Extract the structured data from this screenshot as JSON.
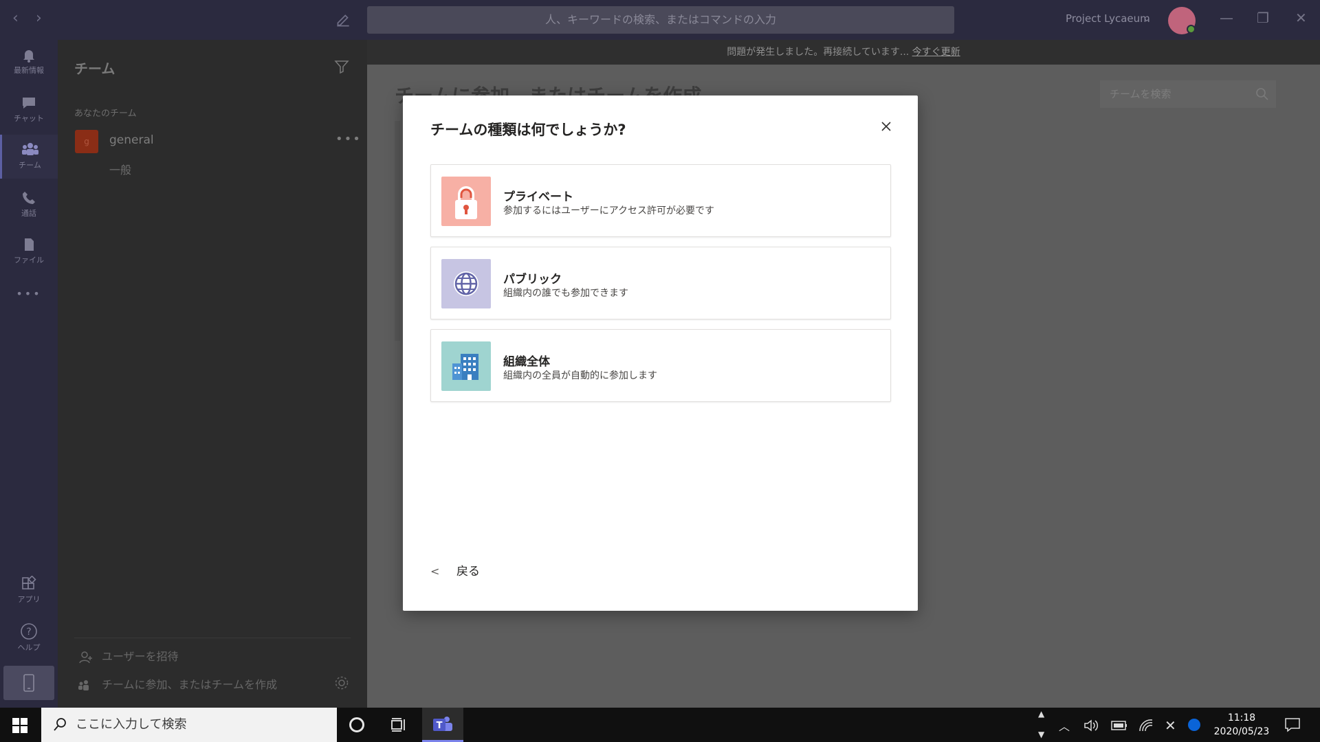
{
  "titlebar": {
    "search_placeholder": "人、キーワードの検索、またはコマンドの入力",
    "tenant": "Project Lycaeum",
    "back_glyph": "‹",
    "forward_glyph": "›"
  },
  "rail": {
    "items": [
      {
        "label": "最新情報",
        "icon": "bell-icon"
      },
      {
        "label": "チャット",
        "icon": "chat-icon"
      },
      {
        "label": "チーム",
        "icon": "teams-icon"
      },
      {
        "label": "通話",
        "icon": "phone-icon"
      },
      {
        "label": "ファイル",
        "icon": "file-icon"
      },
      {
        "label": "アプリ",
        "icon": "apps-icon"
      },
      {
        "label": "ヘルプ",
        "icon": "help-icon"
      }
    ],
    "more": "•••"
  },
  "teams_pane": {
    "title": "チーム",
    "section_label": "あなたのチーム",
    "team": {
      "initial": "g",
      "name": "general",
      "more": "•••"
    },
    "channel": "一般",
    "invite": "ユーザーを招待",
    "join_create": "チームに参加、またはチームを作成"
  },
  "main": {
    "banner_text": "問題が発生しました。再接続しています...",
    "banner_link": "今すぐ更新",
    "heading": "チームに参加、またはチームを作成",
    "search_placeholder": "チームを検索"
  },
  "dialog": {
    "title": "チームの種類は何でしょうか?",
    "options": [
      {
        "title": "プライベート",
        "desc": "参加するにはユーザーにアクセス許可が必要です",
        "icon": "lock-icon",
        "color": "#f7b0a5"
      },
      {
        "title": "パブリック",
        "desc": "組織内の誰でも参加できます",
        "icon": "globe-icon",
        "color": "#c7c5e3"
      },
      {
        "title": "組織全体",
        "desc": "組織内の全員が自動的に参加します",
        "icon": "building-icon",
        "color": "#9fd4d0"
      }
    ],
    "back": "戻る"
  },
  "taskbar": {
    "search_placeholder": "ここに入力して検索",
    "time": "11:18",
    "date": "2020/05/23"
  }
}
